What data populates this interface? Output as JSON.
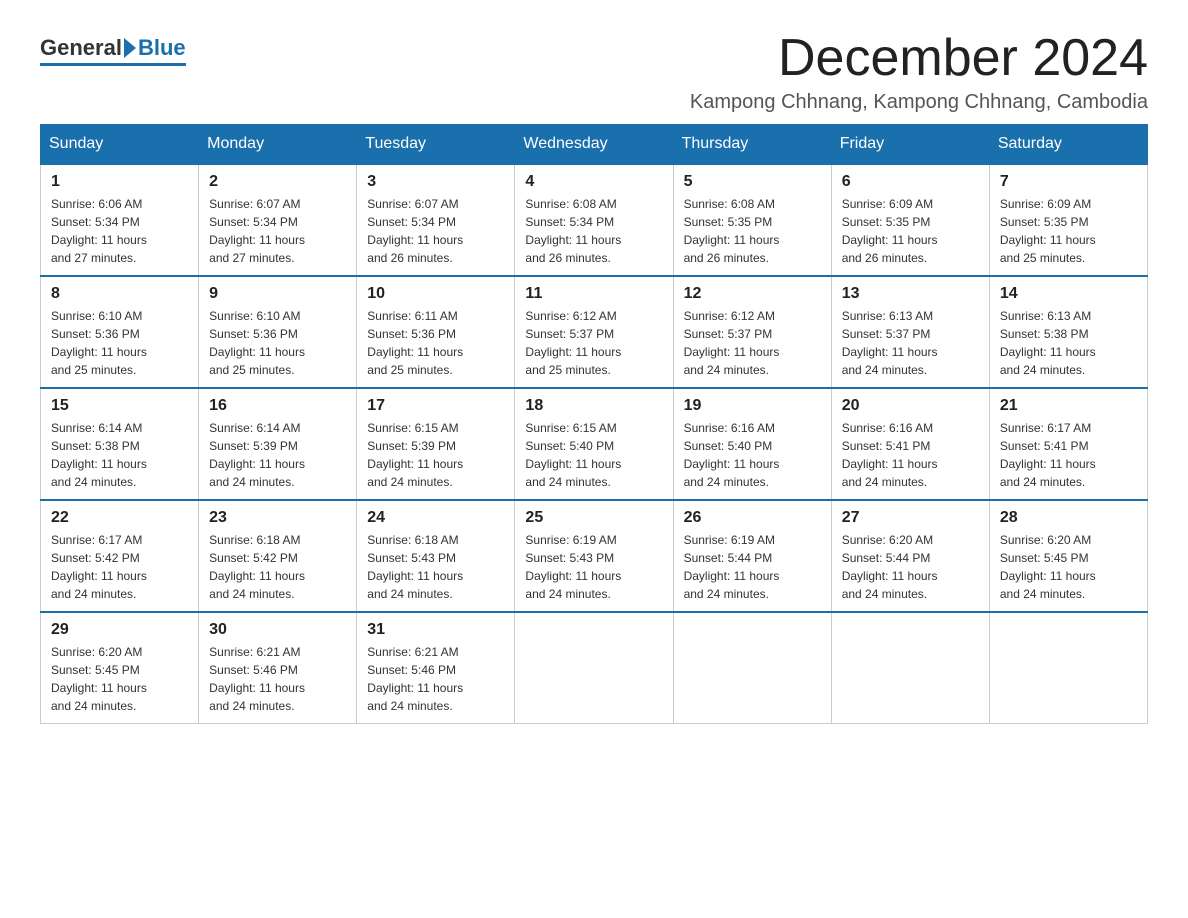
{
  "header": {
    "logo_general": "General",
    "logo_blue": "Blue",
    "month_title": "December 2024",
    "location": "Kampong Chhnang, Kampong Chhnang, Cambodia"
  },
  "weekdays": [
    "Sunday",
    "Monday",
    "Tuesday",
    "Wednesday",
    "Thursday",
    "Friday",
    "Saturday"
  ],
  "weeks": [
    [
      {
        "day": "1",
        "sunrise": "6:06 AM",
        "sunset": "5:34 PM",
        "daylight": "11 hours and 27 minutes."
      },
      {
        "day": "2",
        "sunrise": "6:07 AM",
        "sunset": "5:34 PM",
        "daylight": "11 hours and 27 minutes."
      },
      {
        "day": "3",
        "sunrise": "6:07 AM",
        "sunset": "5:34 PM",
        "daylight": "11 hours and 26 minutes."
      },
      {
        "day": "4",
        "sunrise": "6:08 AM",
        "sunset": "5:34 PM",
        "daylight": "11 hours and 26 minutes."
      },
      {
        "day": "5",
        "sunrise": "6:08 AM",
        "sunset": "5:35 PM",
        "daylight": "11 hours and 26 minutes."
      },
      {
        "day": "6",
        "sunrise": "6:09 AM",
        "sunset": "5:35 PM",
        "daylight": "11 hours and 26 minutes."
      },
      {
        "day": "7",
        "sunrise": "6:09 AM",
        "sunset": "5:35 PM",
        "daylight": "11 hours and 25 minutes."
      }
    ],
    [
      {
        "day": "8",
        "sunrise": "6:10 AM",
        "sunset": "5:36 PM",
        "daylight": "11 hours and 25 minutes."
      },
      {
        "day": "9",
        "sunrise": "6:10 AM",
        "sunset": "5:36 PM",
        "daylight": "11 hours and 25 minutes."
      },
      {
        "day": "10",
        "sunrise": "6:11 AM",
        "sunset": "5:36 PM",
        "daylight": "11 hours and 25 minutes."
      },
      {
        "day": "11",
        "sunrise": "6:12 AM",
        "sunset": "5:37 PM",
        "daylight": "11 hours and 25 minutes."
      },
      {
        "day": "12",
        "sunrise": "6:12 AM",
        "sunset": "5:37 PM",
        "daylight": "11 hours and 24 minutes."
      },
      {
        "day": "13",
        "sunrise": "6:13 AM",
        "sunset": "5:37 PM",
        "daylight": "11 hours and 24 minutes."
      },
      {
        "day": "14",
        "sunrise": "6:13 AM",
        "sunset": "5:38 PM",
        "daylight": "11 hours and 24 minutes."
      }
    ],
    [
      {
        "day": "15",
        "sunrise": "6:14 AM",
        "sunset": "5:38 PM",
        "daylight": "11 hours and 24 minutes."
      },
      {
        "day": "16",
        "sunrise": "6:14 AM",
        "sunset": "5:39 PM",
        "daylight": "11 hours and 24 minutes."
      },
      {
        "day": "17",
        "sunrise": "6:15 AM",
        "sunset": "5:39 PM",
        "daylight": "11 hours and 24 minutes."
      },
      {
        "day": "18",
        "sunrise": "6:15 AM",
        "sunset": "5:40 PM",
        "daylight": "11 hours and 24 minutes."
      },
      {
        "day": "19",
        "sunrise": "6:16 AM",
        "sunset": "5:40 PM",
        "daylight": "11 hours and 24 minutes."
      },
      {
        "day": "20",
        "sunrise": "6:16 AM",
        "sunset": "5:41 PM",
        "daylight": "11 hours and 24 minutes."
      },
      {
        "day": "21",
        "sunrise": "6:17 AM",
        "sunset": "5:41 PM",
        "daylight": "11 hours and 24 minutes."
      }
    ],
    [
      {
        "day": "22",
        "sunrise": "6:17 AM",
        "sunset": "5:42 PM",
        "daylight": "11 hours and 24 minutes."
      },
      {
        "day": "23",
        "sunrise": "6:18 AM",
        "sunset": "5:42 PM",
        "daylight": "11 hours and 24 minutes."
      },
      {
        "day": "24",
        "sunrise": "6:18 AM",
        "sunset": "5:43 PM",
        "daylight": "11 hours and 24 minutes."
      },
      {
        "day": "25",
        "sunrise": "6:19 AM",
        "sunset": "5:43 PM",
        "daylight": "11 hours and 24 minutes."
      },
      {
        "day": "26",
        "sunrise": "6:19 AM",
        "sunset": "5:44 PM",
        "daylight": "11 hours and 24 minutes."
      },
      {
        "day": "27",
        "sunrise": "6:20 AM",
        "sunset": "5:44 PM",
        "daylight": "11 hours and 24 minutes."
      },
      {
        "day": "28",
        "sunrise": "6:20 AM",
        "sunset": "5:45 PM",
        "daylight": "11 hours and 24 minutes."
      }
    ],
    [
      {
        "day": "29",
        "sunrise": "6:20 AM",
        "sunset": "5:45 PM",
        "daylight": "11 hours and 24 minutes."
      },
      {
        "day": "30",
        "sunrise": "6:21 AM",
        "sunset": "5:46 PM",
        "daylight": "11 hours and 24 minutes."
      },
      {
        "day": "31",
        "sunrise": "6:21 AM",
        "sunset": "5:46 PM",
        "daylight": "11 hours and 24 minutes."
      },
      null,
      null,
      null,
      null
    ]
  ],
  "labels": {
    "sunrise_prefix": "Sunrise: ",
    "sunset_prefix": "Sunset: ",
    "daylight_prefix": "Daylight: "
  }
}
